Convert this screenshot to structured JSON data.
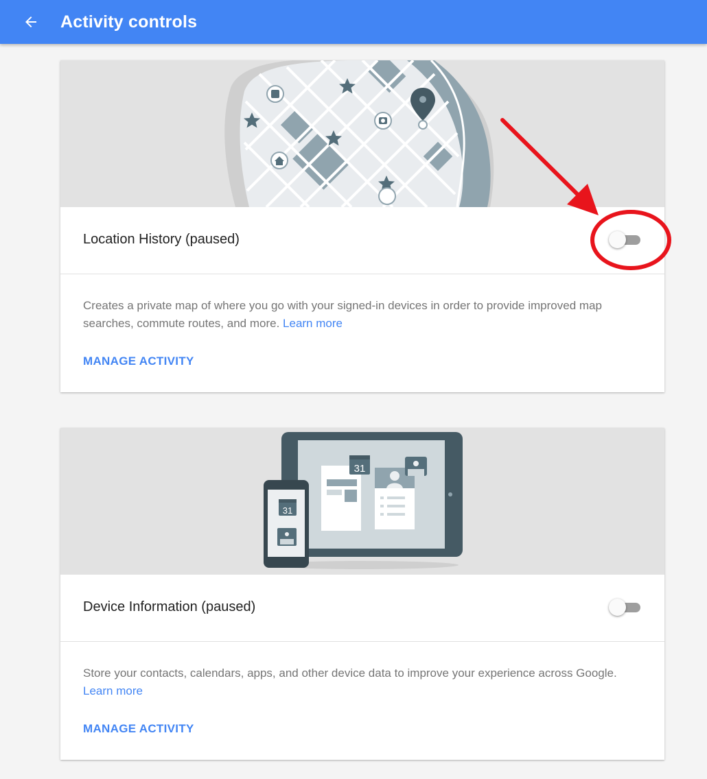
{
  "appbar": {
    "title": "Activity controls",
    "back_icon": "arrow-left-icon",
    "color": "#4285f4"
  },
  "cards": [
    {
      "illustration": "map-illustration",
      "label": "Location History (paused)",
      "toggle_on": false,
      "description": "Creates a private map of where you go with your signed-in devices in order to provide improved map searches, commute routes, and more.",
      "learn_more": "Learn more",
      "manage": "MANAGE ACTIVITY"
    },
    {
      "illustration": "devices-illustration",
      "calendar_day": "31",
      "label": "Device Information (paused)",
      "toggle_on": false,
      "description": "Store your contacts, calendars, apps, and other device data to improve your experience across Google.",
      "learn_more": "Learn more",
      "manage": "MANAGE ACTIVITY"
    }
  ],
  "colors": {
    "accent": "#4285f4",
    "annotation": "#e8141c"
  }
}
